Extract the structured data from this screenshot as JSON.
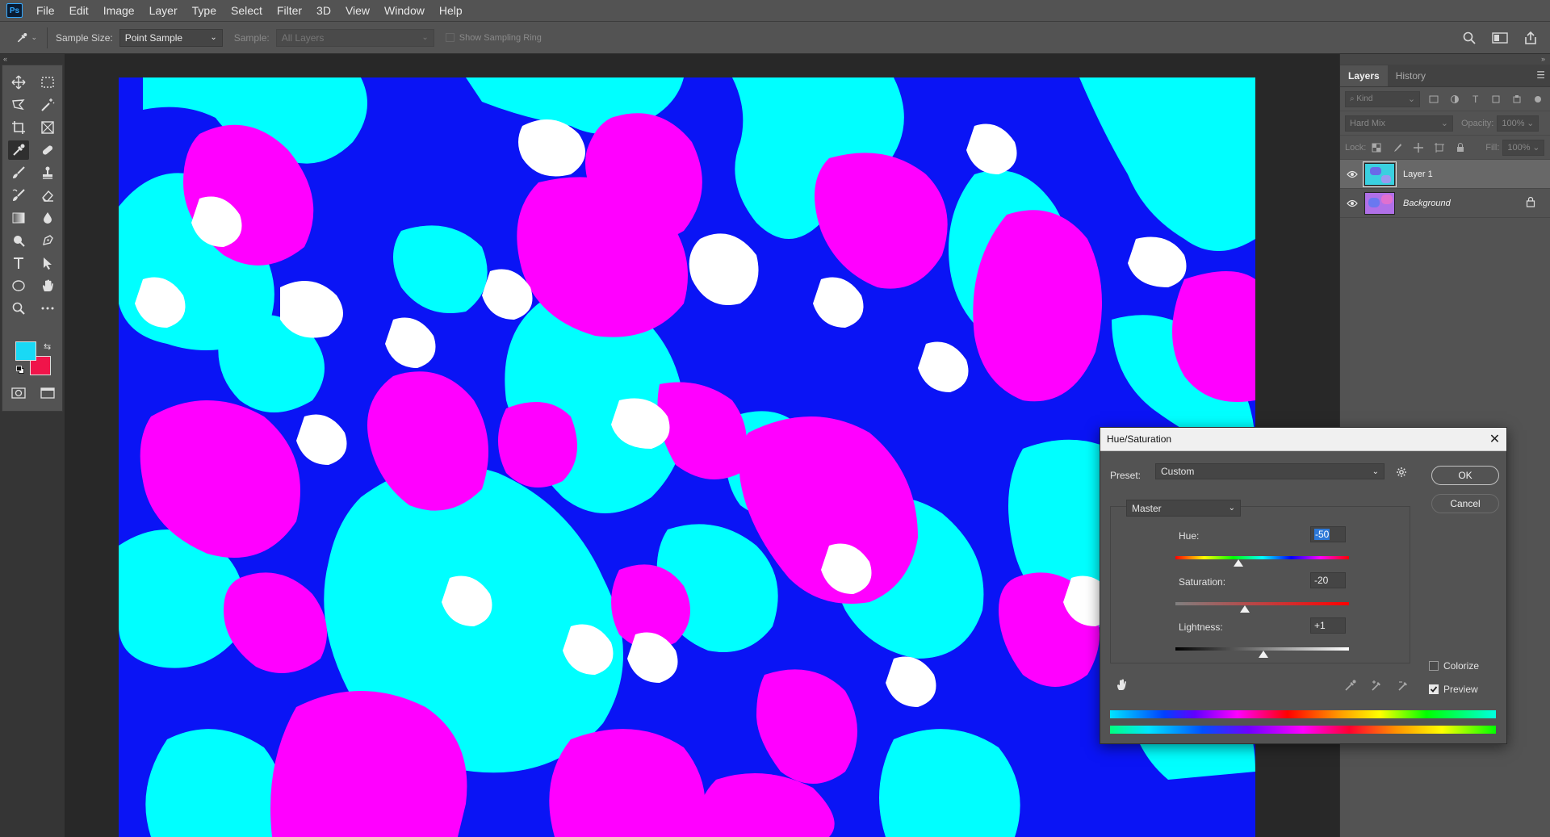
{
  "app": {
    "logo": "Ps",
    "menu": [
      "File",
      "Edit",
      "Image",
      "Layer",
      "Type",
      "Select",
      "Filter",
      "3D",
      "View",
      "Window",
      "Help"
    ]
  },
  "options": {
    "sample_size_label": "Sample Size:",
    "sample_size_value": "Point Sample",
    "sample_label": "Sample:",
    "sample_value": "All Layers",
    "sampling_ring_label": "Show Sampling Ring"
  },
  "tools": {
    "foreground_color": "#19d9f5",
    "background_color": "#f0144a",
    "active": "eyedropper-tool"
  },
  "layers_panel": {
    "tabs": [
      "Layers",
      "History"
    ],
    "kind_placeholder": "Kind",
    "blend_mode": "Hard Mix",
    "opacity_label": "Opacity:",
    "opacity_value": "100%",
    "lock_label": "Lock:",
    "fill_label": "Fill:",
    "fill_value": "100%",
    "layers": [
      {
        "name": "Layer 1",
        "visible": true,
        "selected": true
      },
      {
        "name": "Background",
        "visible": true,
        "selected": false,
        "locked": true
      }
    ]
  },
  "dialog": {
    "title": "Hue/Saturation",
    "preset_label": "Preset:",
    "preset_value": "Custom",
    "channel_value": "Master",
    "ok_label": "OK",
    "cancel_label": "Cancel",
    "hue_label": "Hue:",
    "hue_value": "-50",
    "saturation_label": "Saturation:",
    "saturation_value": "-20",
    "lightness_label": "Lightness:",
    "lightness_value": "+1",
    "colorize_label": "Colorize",
    "colorize_checked": false,
    "preview_label": "Preview",
    "preview_checked": true,
    "hue_range": [
      -180,
      180
    ],
    "saturation_range": [
      -100,
      100
    ],
    "lightness_range": [
      -100,
      100
    ]
  },
  "canvas_colors": [
    "#0a14f5",
    "#00ffff",
    "#ff00ff",
    "#ffffff"
  ]
}
